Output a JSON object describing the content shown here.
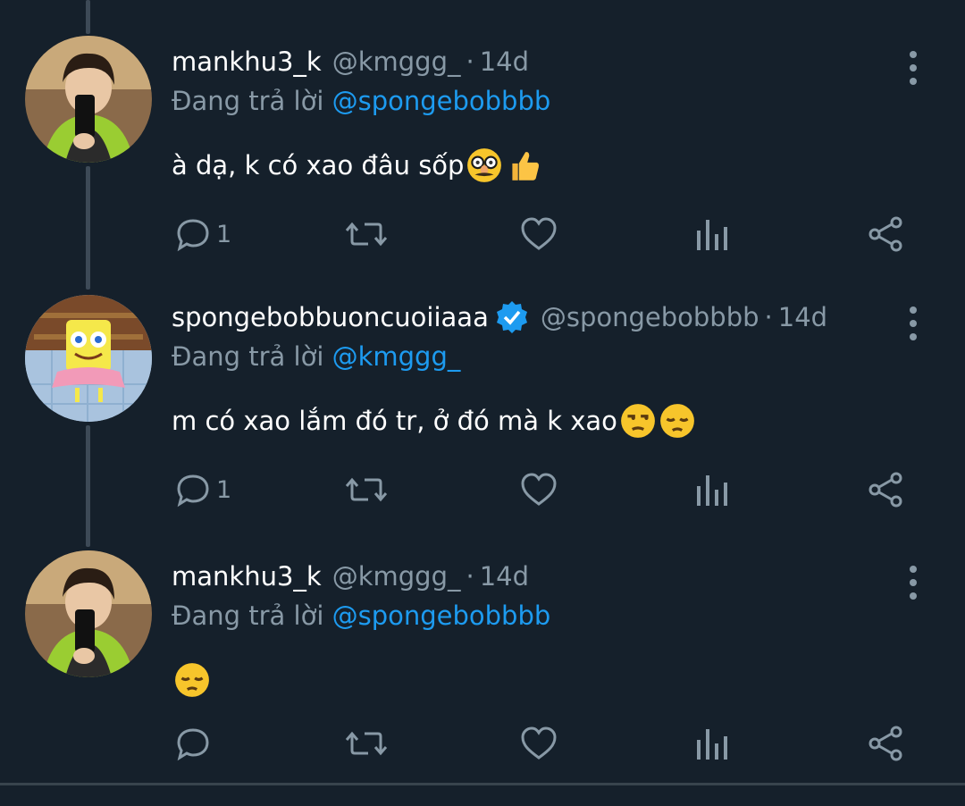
{
  "colors": {
    "background": "#15202b",
    "muted": "#8899a6",
    "mention": "#1d9bf0",
    "verified": "#1d9bf0"
  },
  "tweets": [
    {
      "display_name": "mankhu3_k",
      "handle": "@kmggg_",
      "separator": "·",
      "time": "14d",
      "reply_prefix": "Đang trả lời",
      "reply_mention": "@spongebobbbb",
      "text": "à dạ, k có xao đâu sốp",
      "emojis": [
        "disguised-face-emoji",
        "thumbs-up-emoji"
      ],
      "verified": false,
      "avatar": "avatar-man-selfie",
      "reply_count": "1"
    },
    {
      "display_name": "spongebobbuoncuoiiaaa",
      "handle": "@spongebobbbb",
      "separator": "·",
      "time": "14d",
      "reply_prefix": "Đang trả lời",
      "reply_mention": "@kmggg_",
      "text": "m có xao lắm đó tr, ở đó mà k xao",
      "emojis": [
        "unamused-face-emoji",
        "pensive-face-emoji"
      ],
      "verified": true,
      "avatar": "avatar-spongebob",
      "reply_count": "1"
    },
    {
      "display_name": "mankhu3_k",
      "handle": "@kmggg_",
      "separator": "·",
      "time": "14d",
      "reply_prefix": "Đang trả lời",
      "reply_mention": "@spongebobbbb",
      "text": "",
      "emojis": [
        "pensive-face-emoji"
      ],
      "verified": false,
      "avatar": "avatar-man-selfie",
      "reply_count": ""
    }
  ],
  "icons": [
    "reply-icon",
    "retweet-icon",
    "like-icon",
    "analytics-icon",
    "share-icon",
    "more-icon",
    "verified-badge-icon"
  ]
}
